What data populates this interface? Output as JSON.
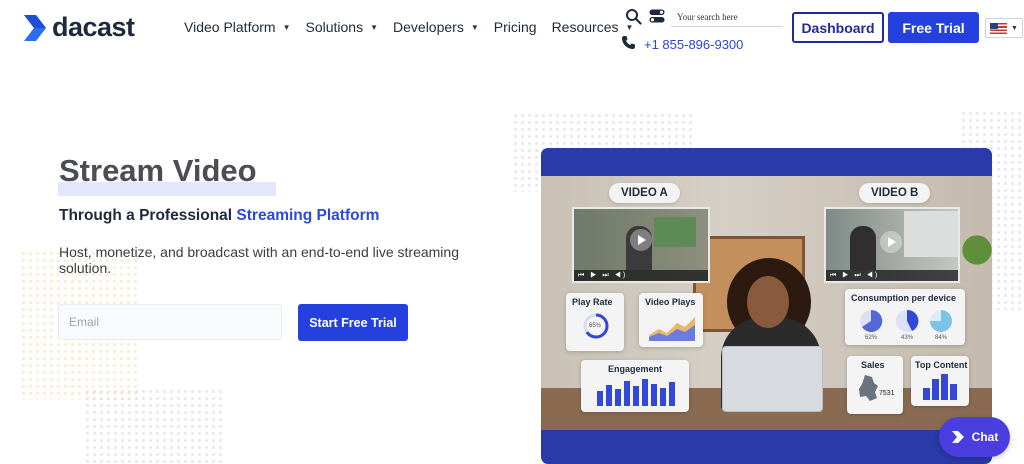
{
  "header": {
    "logo_text": "dacast",
    "nav": [
      {
        "label": "Video Platform",
        "dropdown": true
      },
      {
        "label": "Solutions",
        "dropdown": true
      },
      {
        "label": "Developers",
        "dropdown": true
      },
      {
        "label": "Pricing",
        "dropdown": false
      },
      {
        "label": "Resources",
        "dropdown": true
      }
    ],
    "search_placeholder": "Your search here",
    "phone": "+1 855-896-9300",
    "dashboard_label": "Dashboard",
    "free_trial_label": "Free Trial",
    "language": "en-US"
  },
  "hero": {
    "title": "Stream Video",
    "subtitle_prefix": "Through a Professional ",
    "subtitle_accent": "Streaming Platform",
    "description": "Host, monetize, and broadcast with an end-to-end live streaming solution.",
    "email_placeholder": "Email",
    "cta_label": "Start Free Trial"
  },
  "mockup": {
    "video_a_label": "VIDEO A",
    "video_b_label": "VIDEO B",
    "cards": {
      "play_rate": {
        "title": "Play Rate",
        "value": "65%"
      },
      "video_plays": {
        "title": "Video Plays"
      },
      "consumption": {
        "title": "Consumption per device",
        "values": [
          "62%",
          "43%",
          "84%"
        ]
      },
      "engagement": {
        "title": "Engagement",
        "bars": [
          0.55,
          0.75,
          0.6,
          0.9,
          0.7,
          0.95,
          0.8,
          0.65,
          0.85
        ]
      },
      "sales": {
        "title": "Sales",
        "value": "7531"
      },
      "top_content": {
        "title": "Top Content",
        "bars": [
          0.45,
          0.8,
          1.0,
          0.6
        ]
      }
    }
  },
  "chat": {
    "label": "Chat"
  },
  "colors": {
    "brand": "#2441e0",
    "dark": "#1e2a3b",
    "accent_text": "#2e49d9",
    "chat": "#4a3ee0"
  }
}
